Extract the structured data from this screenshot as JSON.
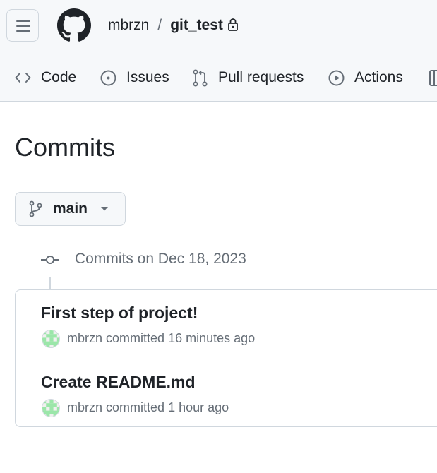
{
  "header": {
    "owner": "mbrzn",
    "separator": "/",
    "repo": "git_test",
    "icons": [
      "menu-icon",
      "github-logo-icon",
      "lock-icon"
    ]
  },
  "tabs": [
    {
      "label": "Code",
      "icon": "code-icon"
    },
    {
      "label": "Issues",
      "icon": "issue-icon"
    },
    {
      "label": "Pull requests",
      "icon": "pull-request-icon"
    },
    {
      "label": "Actions",
      "icon": "play-icon"
    }
  ],
  "page": {
    "title": "Commits",
    "branch": "main",
    "group_heading": "Commits on Dec 18, 2023"
  },
  "commits": [
    {
      "title": "First step of project!",
      "author": "mbrzn",
      "action": "committed",
      "time": "16 minutes ago"
    },
    {
      "title": "Create README.md",
      "author": "mbrzn",
      "action": "committed",
      "time": "1 hour ago"
    }
  ],
  "colors": {
    "text": "#1f2328",
    "muted": "#656d76",
    "border": "#d0d7de",
    "avatar_green": "#9be6a9"
  }
}
